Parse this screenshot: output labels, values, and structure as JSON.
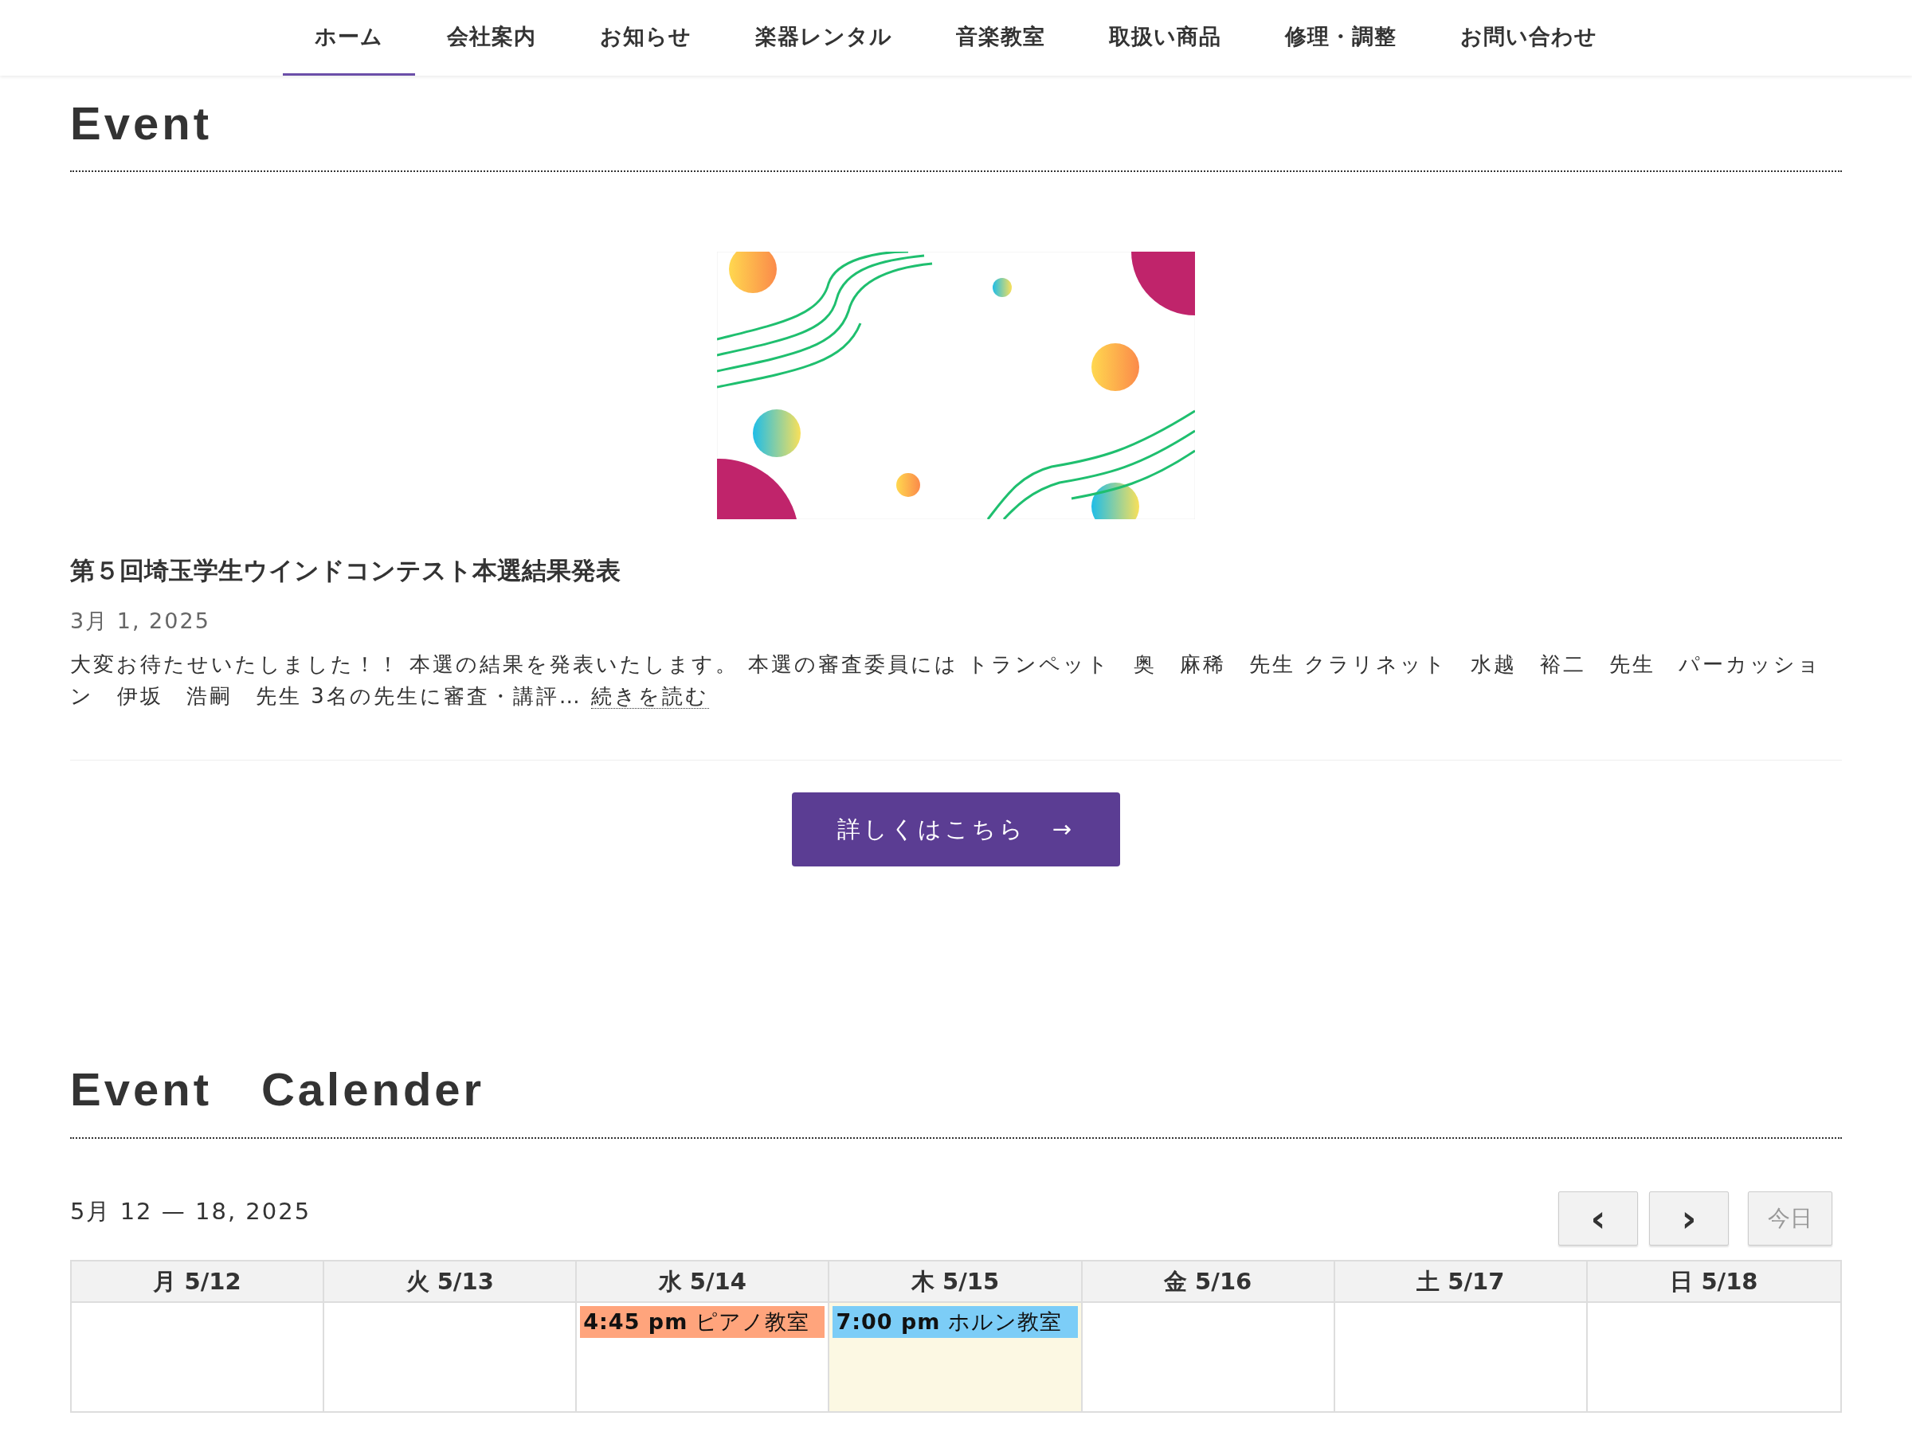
{
  "nav": [
    {
      "label": "ホーム",
      "selected": true
    },
    {
      "label": "会社案内",
      "selected": false
    },
    {
      "label": "お知らせ",
      "selected": false
    },
    {
      "label": "楽器レンタル",
      "selected": false
    },
    {
      "label": "音楽教室",
      "selected": false
    },
    {
      "label": "取扱い商品",
      "selected": false
    },
    {
      "label": "修理・調整",
      "selected": false
    },
    {
      "label": "お問い合わせ",
      "selected": false
    }
  ],
  "event_section": {
    "heading": "Event",
    "post": {
      "title": "第５回埼玉学生ウインドコンテスト本選結果発表",
      "date": "3月 1, 2025",
      "excerpt": "大変お待たせいたしました！！ 本選の結果を発表いたします。 本選の審査委員には トランペット　奥　麻稀　先生 クラリネット　水越　裕二　先生　パーカッション　伊坂　浩嗣　先生 3名の先生に審査・講評…",
      "read_more": "続きを読む"
    },
    "button": "詳しくはこちら　→"
  },
  "calendar_section": {
    "heading": "Event　Calender",
    "range": "5月 12 — 18, 2025",
    "prev": "‹",
    "next": "›",
    "today_button": "今日",
    "days": [
      {
        "label": "月 5/12",
        "today": false
      },
      {
        "label": "火 5/13",
        "today": false
      },
      {
        "label": "水 5/14",
        "today": false,
        "events": [
          {
            "time": "4:45 pm",
            "title": "ピアノ教室",
            "color": "#ffa47c"
          }
        ]
      },
      {
        "label": "木 5/15",
        "today": true,
        "events": [
          {
            "time": "7:00 pm",
            "title": "ホルン教室",
            "color": "#7ccdf7"
          }
        ]
      },
      {
        "label": "金 5/16",
        "today": false
      },
      {
        "label": "土 5/17",
        "today": false
      },
      {
        "label": "日 5/18",
        "today": false
      }
    ]
  }
}
